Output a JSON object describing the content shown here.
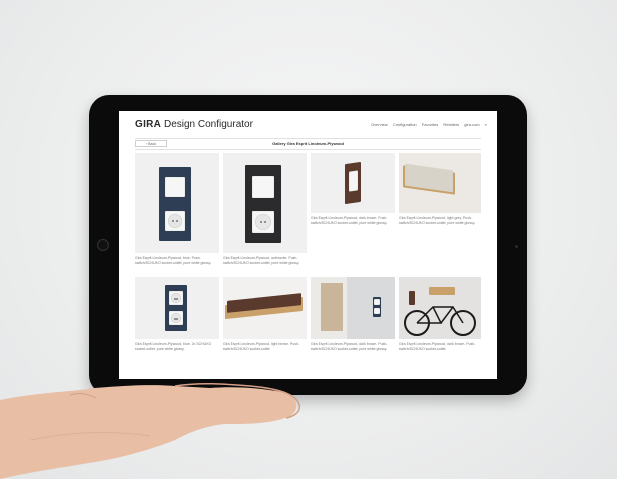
{
  "app": {
    "brand": "GIRA",
    "product": "Design Configurator"
  },
  "nav": [
    "Overview",
    "Configuration",
    "Favorites",
    "Retailers",
    "gira.com"
  ],
  "toolbar": {
    "back_label": "‹ Back",
    "gallery_title": "Gallery Gira Esprit Linoleum-Plywood"
  },
  "gallery": [
    {
      "caption": "Gira Esprit Linoleum-Plywood, blue. Push-switch/SCHUKO socket-outlet, pure white glossy."
    },
    {
      "caption": "Gira Esprit Linoleum-Plywood, anthracite. Push-switch/SCHUKO socket-outlet, pure white glossy."
    },
    {
      "caption": "Gira Esprit Linoleum-Plywood, dark brown. Push-switch/SCHUKO socket-outlet, pure white glossy."
    },
    {
      "caption": "Gira Esprit Linoleum-Plywood, light grey. Push-switch/SCHUKO socket-outlet, pure white glossy."
    },
    {
      "caption": "Gira Esprit Linoleum-Plywood, blue. 2x SCHUKO socket-outlet, pure white glossy."
    },
    {
      "caption": "Gira Esprit Linoleum-Plywood, light brown. Push-switch/SCHUKO socket-outlet."
    },
    {
      "caption": "Gira Esprit Linoleum-Plywood, dark brown. Push-switch/SCHUKO socket-outlet, pure white glossy."
    },
    {
      "caption": "Gira Esprit Linoleum-Plywood, dark brown. Push-switch/SCHUKO socket-outlet."
    }
  ],
  "colors": {
    "plate_blue": "#2e3f55",
    "plate_anthracite": "#2b2b2d",
    "plate_brown": "#5a3a2c",
    "plate_grey": "#d8d3c8",
    "plywood": "#c9a06a",
    "tablet_bezel": "#0b0b0b",
    "skin": "#e9bfa6"
  }
}
